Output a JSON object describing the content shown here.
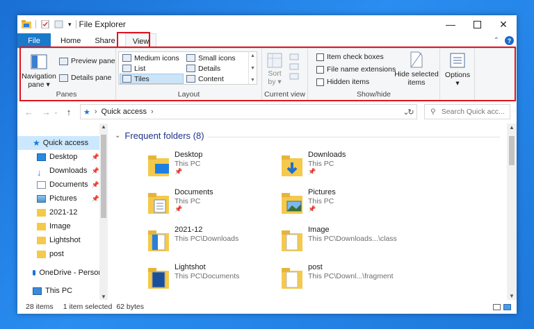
{
  "window": {
    "title": "File Explorer",
    "qat_customize": "▾"
  },
  "tabs": [
    {
      "label": "File"
    },
    {
      "label": "Home"
    },
    {
      "label": "Share"
    },
    {
      "label": "View"
    }
  ],
  "ribbon": {
    "panes": {
      "navigation_pane": "Navigation\npane ▾",
      "preview_pane": "Preview pane",
      "details_pane": "Details pane",
      "group_label": "Panes"
    },
    "layout": {
      "items": [
        "Medium icons",
        "Small icons",
        "List",
        "Details",
        "Tiles",
        "Content"
      ],
      "selected": "Tiles",
      "group_label": "Layout"
    },
    "current_view": {
      "sort_by": "Sort\nby ▾",
      "group_label": "Current view"
    },
    "show_hide": {
      "item_check_boxes": "Item check boxes",
      "file_name_extensions": "File name extensions",
      "hidden_items": "Hidden items",
      "hide_selected_items": "Hide selected\nitems",
      "group_label": "Show/hide"
    },
    "options": {
      "label": "Options\n▾"
    }
  },
  "address": {
    "path": "Quick access",
    "search_placeholder": "Search Quick acc..."
  },
  "nav_pane": {
    "items": [
      {
        "label": "Quick access",
        "icon": "star-icon",
        "pinned": false
      },
      {
        "label": "Desktop",
        "icon": "desktop-icon",
        "pinned": true
      },
      {
        "label": "Downloads",
        "icon": "download-icon",
        "pinned": true
      },
      {
        "label": "Documents",
        "icon": "documents-icon",
        "pinned": true
      },
      {
        "label": "Pictures",
        "icon": "pictures-icon",
        "pinned": true
      },
      {
        "label": "2021-12",
        "icon": "folder-icon",
        "pinned": false
      },
      {
        "label": "Image",
        "icon": "folder-icon",
        "pinned": false
      },
      {
        "label": "Lightshot",
        "icon": "folder-icon",
        "pinned": false
      },
      {
        "label": "post",
        "icon": "folder-icon",
        "pinned": false
      },
      {
        "label": "OneDrive - Persor",
        "icon": "onedrive-icon",
        "pinned": false
      },
      {
        "label": "This PC",
        "icon": "pc-icon",
        "pinned": false
      }
    ]
  },
  "content": {
    "section_title": "Frequent folders (8)",
    "folders": [
      {
        "name": "Desktop",
        "path": "This PC",
        "pinned": true
      },
      {
        "name": "Downloads",
        "path": "This PC",
        "pinned": true
      },
      {
        "name": "Documents",
        "path": "This PC",
        "pinned": true
      },
      {
        "name": "Pictures",
        "path": "This PC",
        "pinned": true
      },
      {
        "name": "2021-12",
        "path": "This PC\\Downloads",
        "pinned": false
      },
      {
        "name": "Image",
        "path": "This PC\\Downloads...\\class",
        "pinned": false
      },
      {
        "name": "Lightshot",
        "path": "This PC\\Documents",
        "pinned": false
      },
      {
        "name": "post",
        "path": "This PC\\Downl...\\fragment",
        "pinned": false
      }
    ]
  },
  "status": {
    "item_count": "28 items",
    "selected": "1 item selected",
    "size": "62 bytes"
  },
  "colors": {
    "accent": "#1979ca",
    "highlight_box": "#e0141f",
    "folder": "#f5c94a",
    "section_title": "#1e3287"
  }
}
